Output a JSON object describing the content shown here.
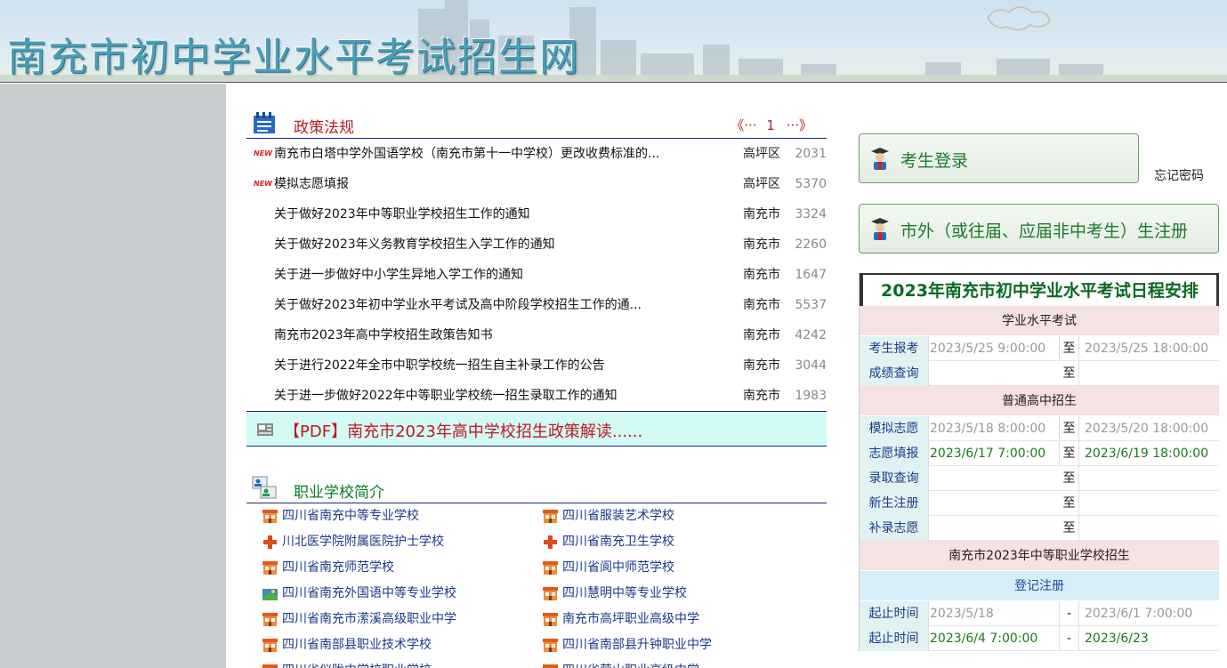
{
  "site": {
    "title": "南充市初中学业水平考试招生网"
  },
  "policy": {
    "title": "政策法规",
    "pager": {
      "prev": "《···",
      "page": "1",
      "next": "···》"
    },
    "new_tag": "NEW",
    "items": [
      {
        "title": "南充市白塔中学外国语学校（南充市第十一中学校）更改收费标准的...",
        "district": "高坪区",
        "count": "2031",
        "is_new": true
      },
      {
        "title": "模拟志愿填报",
        "district": "高坪区",
        "count": "5370",
        "is_new": true
      },
      {
        "title": "关于做好2023年中等职业学校招生工作的通知",
        "district": "南充市",
        "count": "3324",
        "is_new": false
      },
      {
        "title": "关于做好2023年义务教育学校招生入学工作的通知",
        "district": "南充市",
        "count": "2260",
        "is_new": false
      },
      {
        "title": "关于进一步做好中小学生异地入学工作的通知",
        "district": "南充市",
        "count": "1647",
        "is_new": false
      },
      {
        "title": "关于做好2023年初中学业水平考试及高中阶段学校招生工作的通...",
        "district": "南充市",
        "count": "5537",
        "is_new": false
      },
      {
        "title": "南充市2023年高中学校招生政策告知书",
        "district": "南充市",
        "count": "4242",
        "is_new": false
      },
      {
        "title": "关于进行2022年全市中职学校统一招生自主补录工作的公告",
        "district": "南充市",
        "count": "3044",
        "is_new": false
      },
      {
        "title": "关于进一步做好2022年中等职业学校统一招生录取工作的通知",
        "district": "南充市",
        "count": "1983",
        "is_new": false
      }
    ],
    "pdf_link": "【PDF】南充市2023年高中学校招生政策解读......"
  },
  "vocational": {
    "title": "职业学校简介",
    "items": [
      {
        "name": "四川省南充中等专业学校",
        "icon": "school-icon"
      },
      {
        "name": "四川省服装艺术学校",
        "icon": "school-icon"
      },
      {
        "name": "川北医学院附属医院护士学校",
        "icon": "medical-cross-icon"
      },
      {
        "name": "四川省南充卫生学校",
        "icon": "medical-cross-icon"
      },
      {
        "name": "四川省南充师范学校",
        "icon": "school-icon"
      },
      {
        "name": "四川省阆中师范学校",
        "icon": "school-icon"
      },
      {
        "name": "四川省南充外国语中等专业学校",
        "icon": "globe-icon"
      },
      {
        "name": "四川慧明中等专业学校",
        "icon": "school-icon"
      },
      {
        "name": "四川省南充市潆溪高级职业中学",
        "icon": "school-icon"
      },
      {
        "name": "南充市高坪职业高级中学",
        "icon": "school-icon"
      },
      {
        "name": "四川省南部县职业技术学校",
        "icon": "school-icon"
      },
      {
        "name": "四川省南部县升钟职业中学",
        "icon": "school-icon"
      },
      {
        "name": "四川省仪陇中学校职业学校",
        "icon": "school-icon"
      },
      {
        "name": "四川省营山职业高级中学",
        "icon": "school-icon"
      }
    ]
  },
  "login": {
    "student_login": "考生登录",
    "forgot_password": "忘记密码",
    "register": "市外（或往届、应届非中考生）生注册"
  },
  "schedule": {
    "title": "2023年南充市初中学业水平考试日程安排",
    "to_label": "至",
    "dash_label": "-",
    "groups": [
      {
        "name": "学业水平考试",
        "rows": [
          {
            "key": "考生报考",
            "start": "2023/5/25 9:00:00",
            "end": "2023/5/25 18:00:00",
            "active": false
          },
          {
            "key": "成绩查询",
            "start": "",
            "end": "",
            "active": false
          }
        ]
      },
      {
        "name": "普通高中招生",
        "rows": [
          {
            "key": "模拟志愿",
            "start": "2023/5/18 8:00:00",
            "end": "2023/5/20 18:00:00",
            "active": false
          },
          {
            "key": "志愿填报",
            "start": "2023/6/17 7:00:00",
            "end": "2023/6/19 18:00:00",
            "active": true
          },
          {
            "key": "录取查询",
            "start": "",
            "end": "",
            "active": false
          },
          {
            "key": "新生注册",
            "start": "",
            "end": "",
            "active": false
          },
          {
            "key": "补录志愿",
            "start": "",
            "end": "",
            "active": false
          }
        ]
      }
    ],
    "vocational_title": "南充市2023年中等职业学校招生",
    "reg_title": "登记注册",
    "reg_rows": [
      {
        "key": "起止时间",
        "start": "2023/5/18",
        "end": "2023/6/1 7:00:00",
        "active": false
      },
      {
        "key": "起止时间",
        "start": "2023/6/4 7:00:00",
        "end": "2023/6/23",
        "active": true
      }
    ]
  },
  "colors": {
    "policy_title": "#b01f24",
    "vocational_title": "#0a7a2c",
    "pdf_bar_bg": "#d3fbf5",
    "schedule_title": "#0a6a20"
  }
}
